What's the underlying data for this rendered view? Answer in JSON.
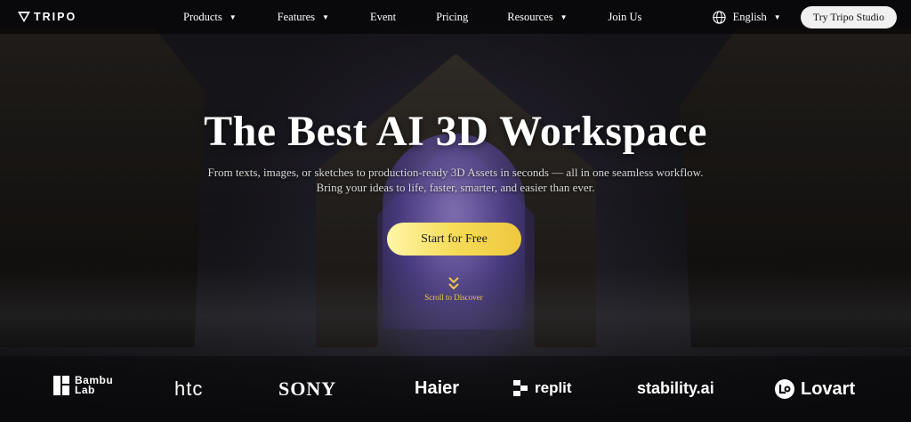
{
  "nav": {
    "logo_text": "TRIPO",
    "items": [
      {
        "label": "Products",
        "dropdown": true
      },
      {
        "label": "Features",
        "dropdown": true
      },
      {
        "label": "Event",
        "dropdown": false
      },
      {
        "label": "Pricing",
        "dropdown": false
      },
      {
        "label": "Resources",
        "dropdown": true
      },
      {
        "label": "Join Us",
        "dropdown": false
      }
    ],
    "language": "English",
    "cta": "Try Tripo Studio"
  },
  "hero": {
    "title": "The Best AI 3D Workspace",
    "subtitle_line1": "From texts, images, or sketches to production-ready 3D Assets in seconds — all in one seamless workflow.",
    "subtitle_line2": "Bring your ideas to life, faster, smarter, and easier than ever.",
    "primary_button": "Start for Free",
    "scroll_label": "Scroll to Discover"
  },
  "partners": {
    "bambu_line1": "Bambu",
    "bambu_line2": "Lab",
    "htc": "htc",
    "sony": "SONY",
    "haier": "Haier",
    "replit": "replit",
    "stability": "stability.ai",
    "lovart": "Lovart"
  },
  "colors": {
    "accent_yellow": "#f6dc58",
    "scroll_gold": "#f1c94a",
    "portal_purple": "#8f78dc"
  }
}
